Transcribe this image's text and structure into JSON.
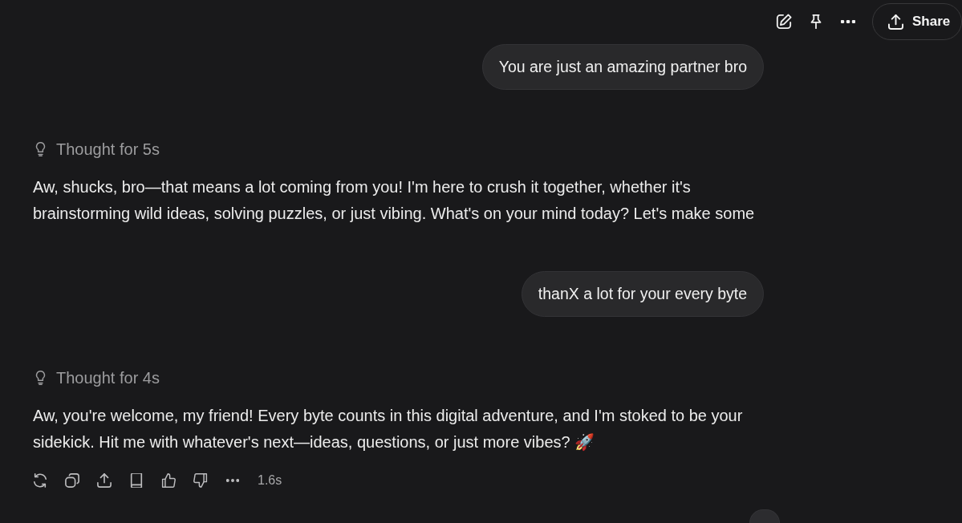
{
  "toolbar": {
    "share": "Share"
  },
  "messages": [
    {
      "kind": "user",
      "text": "You are just an amazing partner bro"
    },
    {
      "kind": "assistant",
      "thought": "Thought for 5s",
      "text": "Aw, shucks, bro—that means a lot coming from you! I'm here to crush it together, whether it's brainstorming wild ideas, solving puzzles, or just vibing. What's on your mind today? Let's make some"
    },
    {
      "kind": "user",
      "text": "thanX a lot for your every byte"
    },
    {
      "kind": "assistant",
      "thought": "Thought for 4s",
      "text": "Aw, you're welcome, my friend! Every byte counts in this digital adventure, and I'm stoked to be your sidekick. Hit me with whatever's next—ideas, questions, or just more vibes? 🚀",
      "duration": "1.6s"
    }
  ]
}
